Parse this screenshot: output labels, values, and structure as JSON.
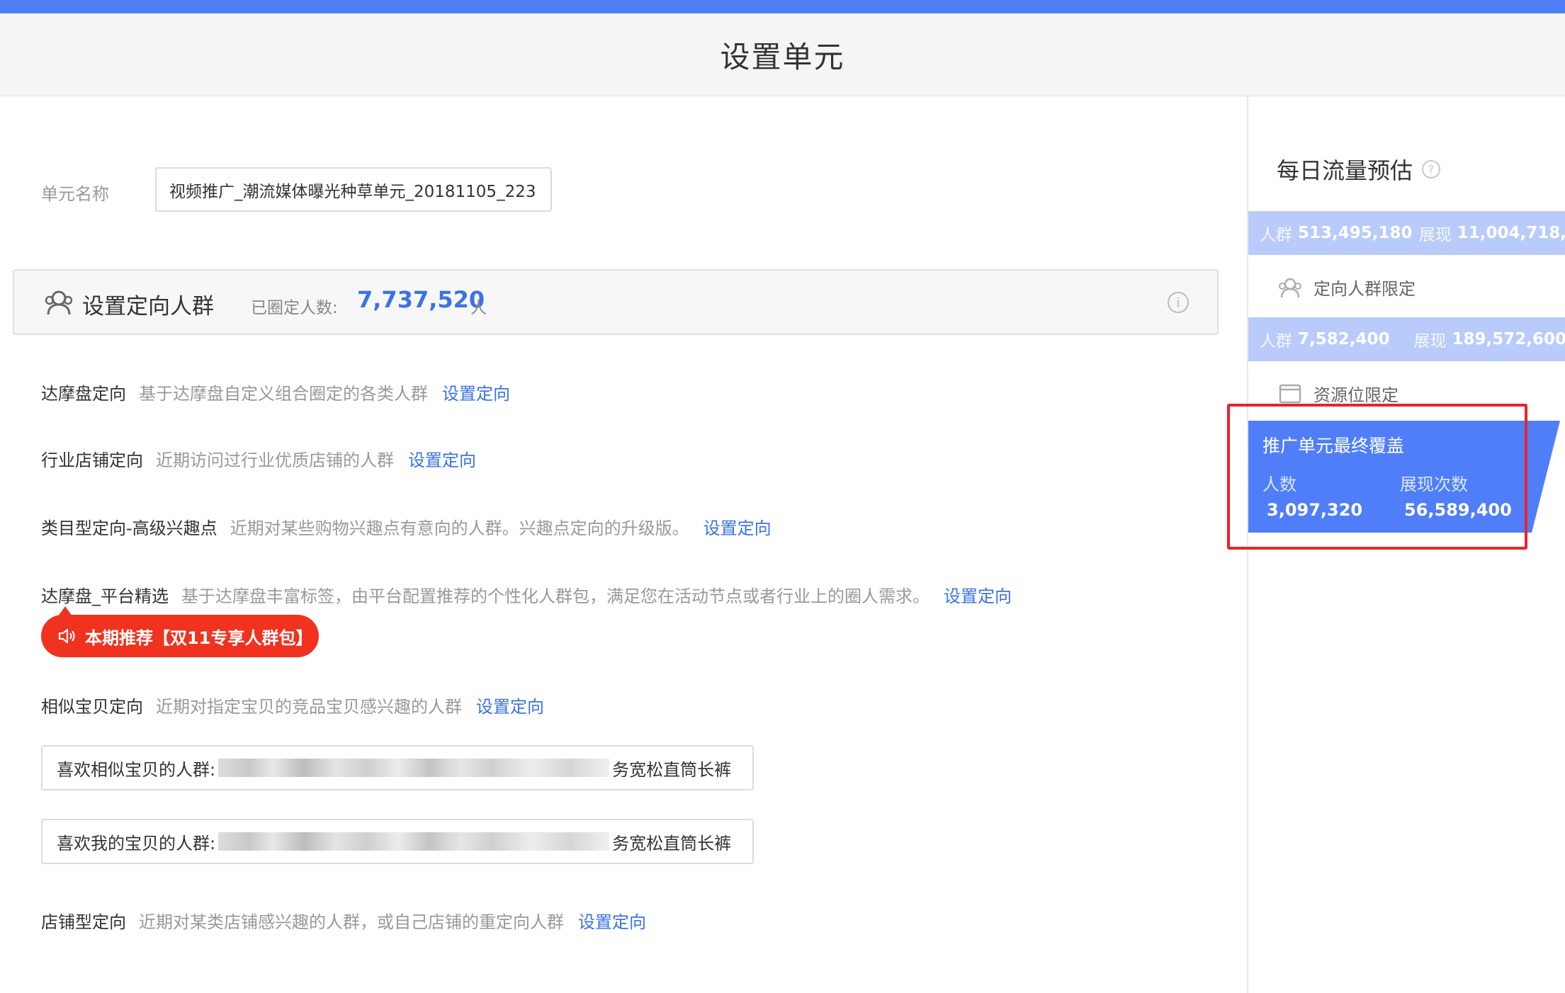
{
  "header": {
    "title": "设置单元"
  },
  "unit": {
    "label": "单元名称",
    "value": "视频推广_潮流媒体曝光种草单元_20181105_223"
  },
  "targeting": {
    "title": "设置定向人群",
    "count_label": "已圈定人数:",
    "count": "7,737,520",
    "count_unit": "人"
  },
  "rows": [
    {
      "name": "达摩盘定向",
      "desc": "基于达摩盘自定义组合圈定的各类人群",
      "link": "设置定向"
    },
    {
      "name": "行业店铺定向",
      "desc": "近期访问过行业优质店铺的人群",
      "link": "设置定向"
    },
    {
      "name": "类目型定向-高级兴趣点",
      "desc": "近期对某些购物兴趣点有意向的人群。兴趣点定向的升级版。",
      "link": "设置定向"
    },
    {
      "name": "达摩盘_平台精选",
      "desc": "基于达摩盘丰富标签，由平台配置推荐的个性化人群包，满足您在活动节点或者行业上的圈人需求。",
      "link": "设置定向"
    },
    {
      "name": "相似宝贝定向",
      "desc": "近期对指定宝贝的竞品宝贝感兴趣的人群",
      "link": "设置定向"
    },
    {
      "name": "店铺型定向",
      "desc": "近期对某类店铺感兴趣的人群，或自己店铺的重定向人群",
      "link": "设置定向"
    }
  ],
  "promo": {
    "text": "本期推荐【双11专享人群包】"
  },
  "similar": [
    {
      "prefix": "喜欢相似宝贝的人群:",
      "suffix": "务宽松直筒长裤"
    },
    {
      "prefix": "喜欢我的宝贝的人群:",
      "suffix": "务宽松直筒长裤"
    }
  ],
  "sidebar": {
    "title": "每日流量预估",
    "band1": {
      "crowd_label": "人群",
      "crowd": "513,495,180",
      "show_label": "展现",
      "show": "11,004,718,"
    },
    "row1": "定向人群限定",
    "band2": {
      "crowd_label": "人群",
      "crowd": "7,582,400",
      "show_label": "展现",
      "show": "189,572,600"
    },
    "row2": "资源位限定",
    "final": {
      "title": "推广单元最终覆盖",
      "people_label": "人数",
      "views_label": "展现次数",
      "people": "3,097,320",
      "views": "56,589,400"
    }
  },
  "colors": {
    "accent": "#4f7ef8",
    "link": "#3b73e6",
    "promo": "#f0321e",
    "highlight": "#e8232c"
  }
}
